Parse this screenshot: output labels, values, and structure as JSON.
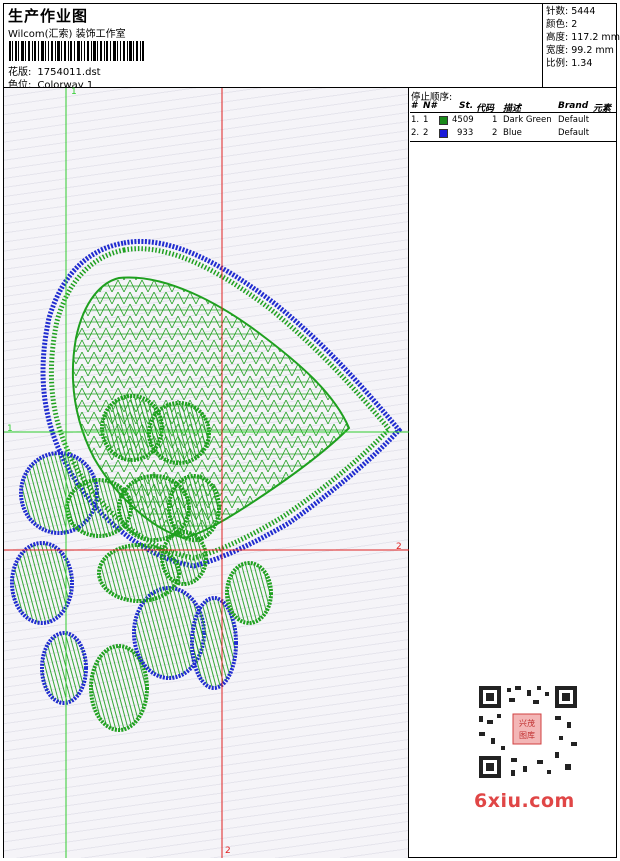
{
  "header": {
    "title": "生产作业图",
    "company": "Wilcom(汇索) 装饰工作室",
    "design_label": "花版:",
    "design_value": "1754011.dst",
    "colorway_label": "色位:",
    "colorway_value": "Colorway 1"
  },
  "stats": {
    "stitches": "针数: 5444",
    "colors": "颜色: 2",
    "height": "高度: 117.2 mm",
    "width": "宽度: 99.2 mm",
    "scale": "比例: 1.34"
  },
  "guides": {
    "v1_label": "1",
    "h1_label": "1",
    "h2_label": "2",
    "v2_label": "2"
  },
  "stop_sequence": {
    "title": "停止顺序:",
    "columns": [
      "#",
      "N#",
      "St.",
      "代码",
      "描述",
      "Brand",
      "元素"
    ],
    "rows": [
      {
        "idx": "1.",
        "n": "1",
        "st": "4509",
        "code": "1",
        "desc": "Dark Green",
        "brand": "Default",
        "color": "#1a8a1a"
      },
      {
        "idx": "2.",
        "n": "2",
        "st": "933",
        "code": "2",
        "desc": "Blue",
        "brand": "Default",
        "color": "#1a1ad8"
      }
    ]
  },
  "watermark": {
    "qr_text": "兴茂图库",
    "logo": "6xiu.com"
  },
  "colors": {
    "thread_green": "#1fa01f",
    "thread_blue": "#1f2bd0",
    "guide_green": "#2ecc2e",
    "guide_red": "#e02020"
  }
}
